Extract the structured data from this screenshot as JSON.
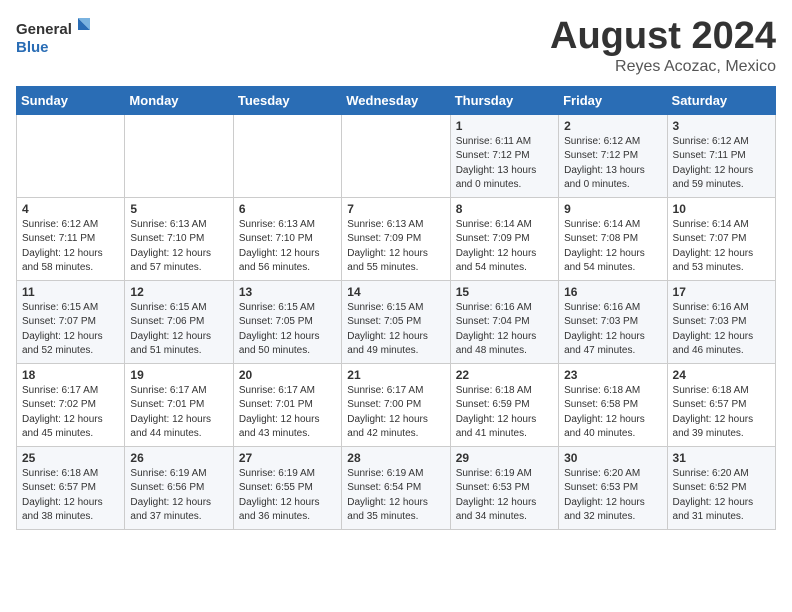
{
  "logo": {
    "general": "General",
    "blue": "Blue"
  },
  "header": {
    "title": "August 2024",
    "subtitle": "Reyes Acozac, Mexico"
  },
  "days_of_week": [
    "Sunday",
    "Monday",
    "Tuesday",
    "Wednesday",
    "Thursday",
    "Friday",
    "Saturday"
  ],
  "weeks": [
    [
      {
        "day": "",
        "sunrise": "",
        "sunset": "",
        "daylight": ""
      },
      {
        "day": "",
        "sunrise": "",
        "sunset": "",
        "daylight": ""
      },
      {
        "day": "",
        "sunrise": "",
        "sunset": "",
        "daylight": ""
      },
      {
        "day": "",
        "sunrise": "",
        "sunset": "",
        "daylight": ""
      },
      {
        "day": "1",
        "sunrise": "Sunrise: 6:11 AM",
        "sunset": "Sunset: 7:12 PM",
        "daylight": "Daylight: 13 hours and 0 minutes."
      },
      {
        "day": "2",
        "sunrise": "Sunrise: 6:12 AM",
        "sunset": "Sunset: 7:12 PM",
        "daylight": "Daylight: 13 hours and 0 minutes."
      },
      {
        "day": "3",
        "sunrise": "Sunrise: 6:12 AM",
        "sunset": "Sunset: 7:11 PM",
        "daylight": "Daylight: 12 hours and 59 minutes."
      }
    ],
    [
      {
        "day": "4",
        "sunrise": "Sunrise: 6:12 AM",
        "sunset": "Sunset: 7:11 PM",
        "daylight": "Daylight: 12 hours and 58 minutes."
      },
      {
        "day": "5",
        "sunrise": "Sunrise: 6:13 AM",
        "sunset": "Sunset: 7:10 PM",
        "daylight": "Daylight: 12 hours and 57 minutes."
      },
      {
        "day": "6",
        "sunrise": "Sunrise: 6:13 AM",
        "sunset": "Sunset: 7:10 PM",
        "daylight": "Daylight: 12 hours and 56 minutes."
      },
      {
        "day": "7",
        "sunrise": "Sunrise: 6:13 AM",
        "sunset": "Sunset: 7:09 PM",
        "daylight": "Daylight: 12 hours and 55 minutes."
      },
      {
        "day": "8",
        "sunrise": "Sunrise: 6:14 AM",
        "sunset": "Sunset: 7:09 PM",
        "daylight": "Daylight: 12 hours and 54 minutes."
      },
      {
        "day": "9",
        "sunrise": "Sunrise: 6:14 AM",
        "sunset": "Sunset: 7:08 PM",
        "daylight": "Daylight: 12 hours and 54 minutes."
      },
      {
        "day": "10",
        "sunrise": "Sunrise: 6:14 AM",
        "sunset": "Sunset: 7:07 PM",
        "daylight": "Daylight: 12 hours and 53 minutes."
      }
    ],
    [
      {
        "day": "11",
        "sunrise": "Sunrise: 6:15 AM",
        "sunset": "Sunset: 7:07 PM",
        "daylight": "Daylight: 12 hours and 52 minutes."
      },
      {
        "day": "12",
        "sunrise": "Sunrise: 6:15 AM",
        "sunset": "Sunset: 7:06 PM",
        "daylight": "Daylight: 12 hours and 51 minutes."
      },
      {
        "day": "13",
        "sunrise": "Sunrise: 6:15 AM",
        "sunset": "Sunset: 7:05 PM",
        "daylight": "Daylight: 12 hours and 50 minutes."
      },
      {
        "day": "14",
        "sunrise": "Sunrise: 6:15 AM",
        "sunset": "Sunset: 7:05 PM",
        "daylight": "Daylight: 12 hours and 49 minutes."
      },
      {
        "day": "15",
        "sunrise": "Sunrise: 6:16 AM",
        "sunset": "Sunset: 7:04 PM",
        "daylight": "Daylight: 12 hours and 48 minutes."
      },
      {
        "day": "16",
        "sunrise": "Sunrise: 6:16 AM",
        "sunset": "Sunset: 7:03 PM",
        "daylight": "Daylight: 12 hours and 47 minutes."
      },
      {
        "day": "17",
        "sunrise": "Sunrise: 6:16 AM",
        "sunset": "Sunset: 7:03 PM",
        "daylight": "Daylight: 12 hours and 46 minutes."
      }
    ],
    [
      {
        "day": "18",
        "sunrise": "Sunrise: 6:17 AM",
        "sunset": "Sunset: 7:02 PM",
        "daylight": "Daylight: 12 hours and 45 minutes."
      },
      {
        "day": "19",
        "sunrise": "Sunrise: 6:17 AM",
        "sunset": "Sunset: 7:01 PM",
        "daylight": "Daylight: 12 hours and 44 minutes."
      },
      {
        "day": "20",
        "sunrise": "Sunrise: 6:17 AM",
        "sunset": "Sunset: 7:01 PM",
        "daylight": "Daylight: 12 hours and 43 minutes."
      },
      {
        "day": "21",
        "sunrise": "Sunrise: 6:17 AM",
        "sunset": "Sunset: 7:00 PM",
        "daylight": "Daylight: 12 hours and 42 minutes."
      },
      {
        "day": "22",
        "sunrise": "Sunrise: 6:18 AM",
        "sunset": "Sunset: 6:59 PM",
        "daylight": "Daylight: 12 hours and 41 minutes."
      },
      {
        "day": "23",
        "sunrise": "Sunrise: 6:18 AM",
        "sunset": "Sunset: 6:58 PM",
        "daylight": "Daylight: 12 hours and 40 minutes."
      },
      {
        "day": "24",
        "sunrise": "Sunrise: 6:18 AM",
        "sunset": "Sunset: 6:57 PM",
        "daylight": "Daylight: 12 hours and 39 minutes."
      }
    ],
    [
      {
        "day": "25",
        "sunrise": "Sunrise: 6:18 AM",
        "sunset": "Sunset: 6:57 PM",
        "daylight": "Daylight: 12 hours and 38 minutes."
      },
      {
        "day": "26",
        "sunrise": "Sunrise: 6:19 AM",
        "sunset": "Sunset: 6:56 PM",
        "daylight": "Daylight: 12 hours and 37 minutes."
      },
      {
        "day": "27",
        "sunrise": "Sunrise: 6:19 AM",
        "sunset": "Sunset: 6:55 PM",
        "daylight": "Daylight: 12 hours and 36 minutes."
      },
      {
        "day": "28",
        "sunrise": "Sunrise: 6:19 AM",
        "sunset": "Sunset: 6:54 PM",
        "daylight": "Daylight: 12 hours and 35 minutes."
      },
      {
        "day": "29",
        "sunrise": "Sunrise: 6:19 AM",
        "sunset": "Sunset: 6:53 PM",
        "daylight": "Daylight: 12 hours and 34 minutes."
      },
      {
        "day": "30",
        "sunrise": "Sunrise: 6:20 AM",
        "sunset": "Sunset: 6:53 PM",
        "daylight": "Daylight: 12 hours and 32 minutes."
      },
      {
        "day": "31",
        "sunrise": "Sunrise: 6:20 AM",
        "sunset": "Sunset: 6:52 PM",
        "daylight": "Daylight: 12 hours and 31 minutes."
      }
    ]
  ]
}
